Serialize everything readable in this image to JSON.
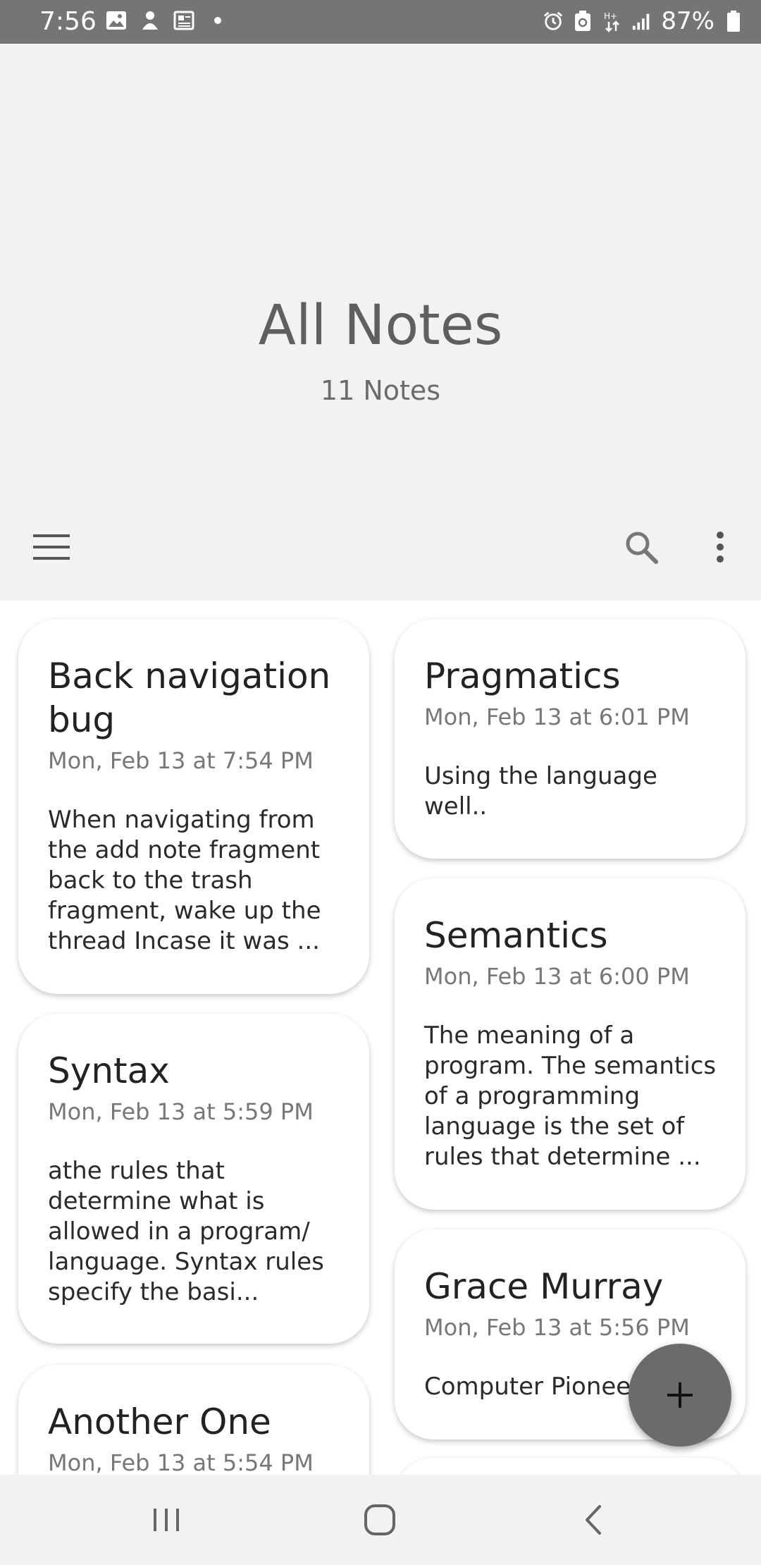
{
  "status_bar": {
    "time": "7:56",
    "battery": "87%",
    "left_icons": [
      "image-icon",
      "notification-icon",
      "news-icon",
      "dot-icon"
    ],
    "right_icons": [
      "alarm-icon",
      "battery-saver-icon",
      "data-icon",
      "signal-icon",
      "battery-icon"
    ]
  },
  "header": {
    "title": "All Notes",
    "count": "11 Notes"
  },
  "toolbar": {
    "icons": [
      "menu-icon",
      "search-icon",
      "more-vert-icon"
    ]
  },
  "notes": {
    "left": [
      {
        "title": "Back navigation bug",
        "date": "Mon, Feb 13 at 7:54 PM",
        "body": "When navigating from the add note fragment back to the trash fragment, wake up the thread Incase it was ..."
      },
      {
        "title": "Syntax",
        "date": "Mon, Feb 13 at 5:59 PM",
        "body": "athe rules that determine what is allowed in a program/ language. Syntax rules specify the basi..."
      },
      {
        "title": "Another One",
        "date": "Mon, Feb 13 at 5:54 PM",
        "body": ""
      }
    ],
    "right": [
      {
        "title": "Pragmatics",
        "date": "Mon, Feb 13 at 6:01 PM",
        "body": "Using the language well.."
      },
      {
        "title": "Semantics",
        "date": "Mon, Feb 13 at 6:00 PM",
        "body": "The meaning of a program. The semantics of a programming language is the set of rules that determine ..."
      },
      {
        "title": "Grace Murray",
        "date": "Mon, Feb 13 at 5:56 PM",
        "body": "Computer Pionee"
      }
    ]
  },
  "fab": {
    "icon": "plus-icon"
  },
  "nav_bar": {
    "icons": [
      "recents-icon",
      "home-icon",
      "back-icon"
    ]
  },
  "colors": {
    "status_bar": "#757575",
    "header_bg": "#f2f2f2",
    "fab": "#6b6b6b",
    "card_bg": "#ffffff"
  }
}
